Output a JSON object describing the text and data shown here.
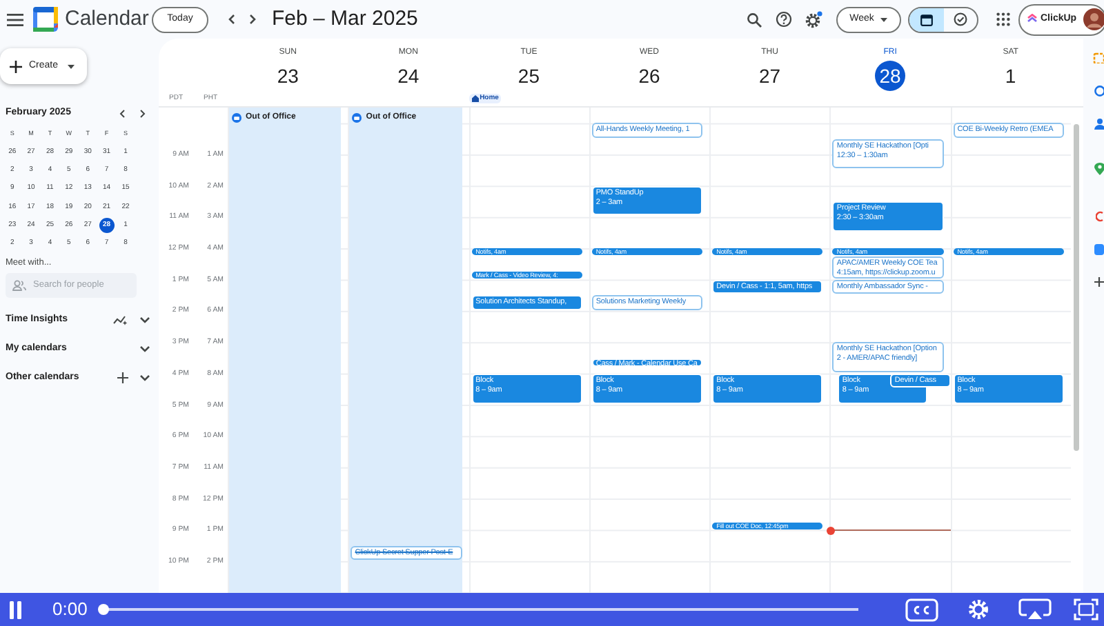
{
  "topbar": {
    "app_title": "Calendar",
    "today_button": "Today",
    "date_range": "Feb – Mar 2025",
    "view_select": "Week",
    "view_toggle": [
      {
        "kind": "calendar",
        "selected": true
      },
      {
        "kind": "tasks",
        "selected": false
      }
    ],
    "account_button": "ClickUp"
  },
  "sidebar": {
    "create_button": "Create",
    "mini_calendar": {
      "title": "February 2025",
      "weekdays": [
        "S",
        "M",
        "T",
        "W",
        "T",
        "F",
        "S"
      ],
      "weeks": [
        [
          {
            "d": "26",
            "selected": false
          },
          {
            "d": "27",
            "selected": false
          },
          {
            "d": "28",
            "selected": false
          },
          {
            "d": "29",
            "selected": false
          },
          {
            "d": "30",
            "selected": false
          },
          {
            "d": "31",
            "selected": false
          },
          {
            "d": "1",
            "selected": false
          }
        ],
        [
          {
            "d": "2",
            "selected": false
          },
          {
            "d": "3",
            "selected": false
          },
          {
            "d": "4",
            "selected": false
          },
          {
            "d": "5",
            "selected": false
          },
          {
            "d": "6",
            "selected": false
          },
          {
            "d": "7",
            "selected": false
          },
          {
            "d": "8",
            "selected": false
          }
        ],
        [
          {
            "d": "9",
            "selected": false
          },
          {
            "d": "10",
            "selected": false
          },
          {
            "d": "11",
            "selected": false
          },
          {
            "d": "12",
            "selected": false
          },
          {
            "d": "13",
            "selected": false
          },
          {
            "d": "14",
            "selected": false
          },
          {
            "d": "15",
            "selected": false
          }
        ],
        [
          {
            "d": "16",
            "selected": false
          },
          {
            "d": "17",
            "selected": false
          },
          {
            "d": "18",
            "selected": false
          },
          {
            "d": "19",
            "selected": false
          },
          {
            "d": "20",
            "selected": false
          },
          {
            "d": "21",
            "selected": false
          },
          {
            "d": "22",
            "selected": false
          }
        ],
        [
          {
            "d": "23",
            "selected": false
          },
          {
            "d": "24",
            "selected": false
          },
          {
            "d": "25",
            "selected": false
          },
          {
            "d": "26",
            "selected": false
          },
          {
            "d": "27",
            "selected": false
          },
          {
            "d": "28",
            "selected": true
          },
          {
            "d": "1",
            "selected": false
          }
        ],
        [
          {
            "d": "2",
            "selected": false
          },
          {
            "d": "3",
            "selected": false
          },
          {
            "d": "4",
            "selected": false
          },
          {
            "d": "5",
            "selected": false
          },
          {
            "d": "6",
            "selected": false
          },
          {
            "d": "7",
            "selected": false
          },
          {
            "d": "8",
            "selected": false
          }
        ]
      ]
    },
    "meet_with": "Meet with...",
    "search": {
      "placeholder": "Search for people"
    },
    "sections": [
      {
        "label": "Time Insights",
        "kind": "insights"
      },
      {
        "label": "My calendars",
        "kind": "plain"
      },
      {
        "label": "Other calendars",
        "kind": "addable"
      }
    ]
  },
  "time_zones": [
    "PDT",
    "PHT"
  ],
  "time_labels": [
    {
      "pdt": "9 AM",
      "pht": "1 AM"
    },
    {
      "pdt": "10 AM",
      "pht": "2 AM"
    },
    {
      "pdt": "11 AM",
      "pht": "3 AM"
    },
    {
      "pdt": "12 PM",
      "pht": "4 AM"
    },
    {
      "pdt": "1 PM",
      "pht": "5 AM"
    },
    {
      "pdt": "2 PM",
      "pht": "6 AM"
    },
    {
      "pdt": "3 PM",
      "pht": "7 AM"
    },
    {
      "pdt": "4 PM",
      "pht": "8 AM"
    },
    {
      "pdt": "5 PM",
      "pht": "9 AM"
    },
    {
      "pdt": "6 PM",
      "pht": "10 AM"
    },
    {
      "pdt": "7 PM",
      "pht": "11 AM"
    },
    {
      "pdt": "8 PM",
      "pht": "12 PM"
    },
    {
      "pdt": "9 PM",
      "pht": "1 PM"
    },
    {
      "pdt": "10 PM",
      "pht": "2 PM"
    }
  ],
  "days": [
    {
      "name": "SUN",
      "number": "23",
      "today": false,
      "events": [
        {
          "kind": "out-of-office",
          "title": "Out of Office"
        }
      ]
    },
    {
      "name": "MON",
      "number": "24",
      "today": false,
      "events": [
        {
          "kind": "out-of-office",
          "title": "Out of Office"
        },
        {
          "kind": "declined",
          "title": "ClickUp Secret Supper Post-E"
        }
      ]
    },
    {
      "name": "TUE",
      "number": "25",
      "today": false,
      "location": "Home",
      "events": [
        {
          "kind": "pill",
          "title": "Notifs, 4am"
        },
        {
          "kind": "pill",
          "title": "Mark / Cass - Video Review, 4:"
        },
        {
          "kind": "filled",
          "title": "Solution Architects Standup,"
        },
        {
          "kind": "filled",
          "title": "Block",
          "time": "8 – 9am"
        }
      ]
    },
    {
      "name": "WED",
      "number": "26",
      "today": false,
      "events": [
        {
          "kind": "outlined",
          "title": "All-Hands Weekly Meeting, 1"
        },
        {
          "kind": "filled",
          "title": "PMO StandUp",
          "time": "2 – 3am"
        },
        {
          "kind": "pill",
          "title": "Notifs, 4am"
        },
        {
          "kind": "outlined",
          "title": "Solutions Marketing Weekly"
        },
        {
          "kind": "filled",
          "title": "Cass / Mark - Calendar Use Ca"
        },
        {
          "kind": "filled",
          "title": "Block",
          "time": "8 – 9am"
        }
      ]
    },
    {
      "name": "THU",
      "number": "27",
      "today": false,
      "events": [
        {
          "kind": "pill",
          "title": "Notifs, 4am"
        },
        {
          "kind": "filled",
          "title": "Devin / Cass - 1:1, 5am, https"
        },
        {
          "kind": "filled",
          "title": "Block",
          "time": "8 – 9am"
        },
        {
          "kind": "pill",
          "title": "Fill out COE Doc, 12:45pm"
        }
      ]
    },
    {
      "name": "FRI",
      "number": "28",
      "today": true,
      "events": [
        {
          "kind": "outlined",
          "title": "Monthly SE Hackathon [Opti",
          "time": "12:30 – 1:30am"
        },
        {
          "kind": "filled",
          "title": "Project Review",
          "time": "2:30 – 3:30am"
        },
        {
          "kind": "pill",
          "title": "Notifs, 4am"
        },
        {
          "kind": "outlined",
          "title": "APAC/AMER Weekly COE Tea",
          "time": "4:15am, https://clickup.zoom.u"
        },
        {
          "kind": "outlined",
          "title": "Monthly Ambassador Sync -"
        },
        {
          "kind": "outlined",
          "title": "Monthly SE Hackathon [Option 2 - AMER/APAC friendly]"
        },
        {
          "kind": "filled",
          "title": "Block",
          "time": "8 – 9am"
        },
        {
          "kind": "filled",
          "title": "Devin / Cass"
        }
      ]
    },
    {
      "name": "SAT",
      "number": "1",
      "today": false,
      "events": [
        {
          "kind": "outlined",
          "title": "COE Bi-Weekly Retro (EMEA"
        },
        {
          "kind": "pill",
          "title": "Notifs, 4am"
        },
        {
          "kind": "filled",
          "title": "Block",
          "time": "8 – 9am"
        }
      ]
    }
  ],
  "player": {
    "playing": true,
    "time": "0:00",
    "level": 0
  }
}
